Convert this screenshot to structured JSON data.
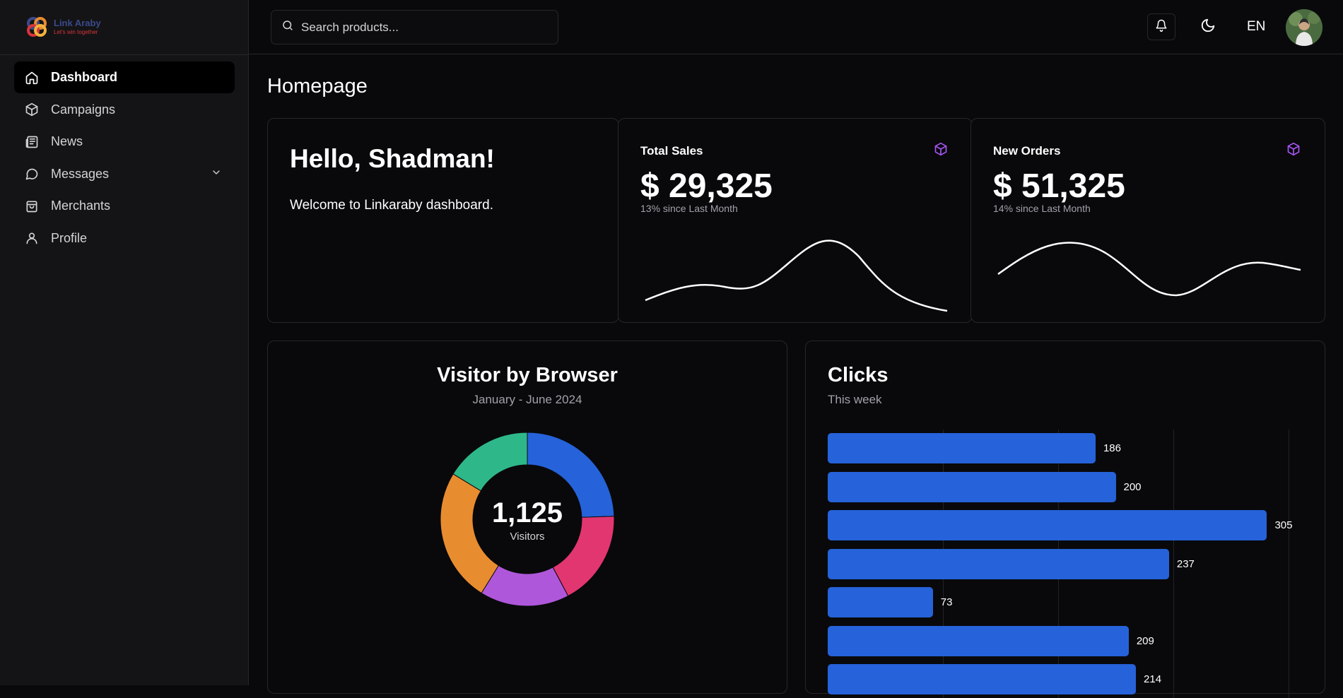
{
  "brand": {
    "name": "Link Araby",
    "tagline": "Let's win together"
  },
  "sidebar": {
    "items": [
      {
        "label": "Dashboard",
        "icon": "home-icon",
        "active": true
      },
      {
        "label": "Campaigns",
        "icon": "box-icon"
      },
      {
        "label": "News",
        "icon": "newspaper-icon"
      },
      {
        "label": "Messages",
        "icon": "message-icon",
        "expandable": true
      },
      {
        "label": "Merchants",
        "icon": "shopping-bag-icon"
      },
      {
        "label": "Profile",
        "icon": "user-icon"
      }
    ]
  },
  "header": {
    "search_placeholder": "Search products...",
    "language": "EN"
  },
  "page": {
    "title": "Homepage"
  },
  "welcome": {
    "greeting": "Hello, Shadman!",
    "message": "Welcome to Linkaraby dashboard."
  },
  "stats": [
    {
      "label": "Total Sales",
      "value": "$ 29,325",
      "change": "13% since Last Month"
    },
    {
      "label": "New Orders",
      "value": "$ 51,325",
      "change": "14% since Last Month"
    }
  ],
  "colors": {
    "accent": "#2662d9",
    "purple": "#a855f7"
  },
  "chart_data": [
    {
      "type": "pie",
      "title": "Visitor by Browser",
      "subtitle": "January - June 2024",
      "center_value": "1,125",
      "center_label": "Visitors",
      "slices": [
        {
          "value": 275,
          "color": "#2662d9"
        },
        {
          "value": 200,
          "color": "#e23670"
        },
        {
          "value": 187,
          "color": "#af57db"
        },
        {
          "value": 280,
          "color": "#e88c30"
        },
        {
          "value": 183,
          "color": "#2eb88a"
        }
      ]
    },
    {
      "type": "bar",
      "title": "Clicks",
      "subtitle": "This week",
      "orientation": "horizontal",
      "values": [
        186,
        200,
        305,
        237,
        73,
        209,
        214
      ],
      "xlim": [
        0,
        320
      ]
    }
  ]
}
